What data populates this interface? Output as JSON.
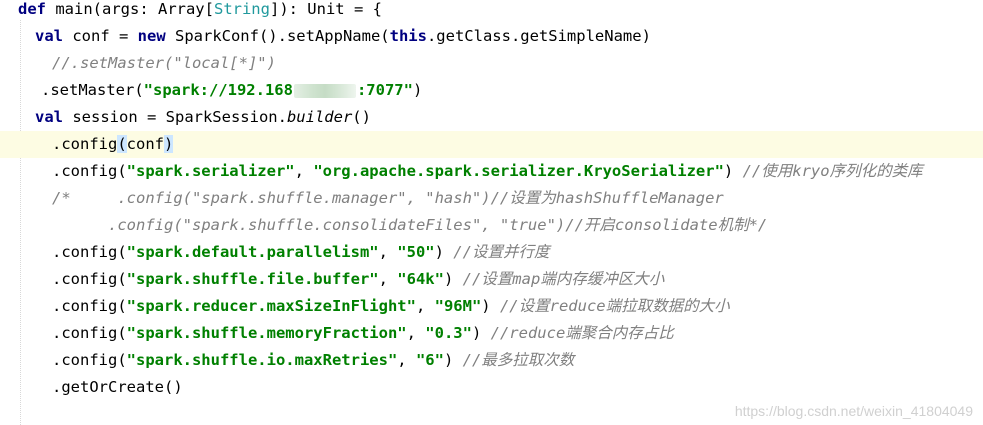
{
  "code": {
    "line1": {
      "def_kw": "def",
      "signature_a": " main(args: Array[",
      "string_type": "String",
      "signature_b": "]): Unit = {"
    },
    "line2": {
      "val_kw": "val",
      "a": " conf = ",
      "new_kw": "new",
      "b": " SparkConf().setAppName(",
      "this_kw": "this",
      "c": ".getClass.getSimpleName)"
    },
    "line3": {
      "comment": "//.setMaster(\"local[*]\")"
    },
    "line4": {
      "a": ".setMaster(",
      "string_visible_start": "\"spark://192.168",
      "string_visible_end": ":7077\"",
      "b": ")"
    },
    "line5": {
      "val_kw": "val",
      "a": " session = SparkSession.",
      "builder": "builder",
      "b": "()"
    },
    "line6": {
      "a": ".config",
      "open_paren": "(",
      "b": "conf",
      "close_paren": ")"
    },
    "line7": {
      "a": ".config(",
      "key": "\"spark.serializer\"",
      "sep": ", ",
      "value": "\"org.apache.spark.serializer.KryoSerializer\"",
      "b": ") ",
      "comment": "//使用kryo序列化的类库"
    },
    "line8": {
      "comment": "/*     .config(\"spark.shuffle.manager\", \"hash\")//设置为hashShuffleManager"
    },
    "line9": {
      "comment": ".config(\"spark.shuffle.consolidateFiles\", \"true\")//开启consolidate机制*/"
    },
    "config_lines": [
      {
        "a": ".config(",
        "key": "\"spark.default.parallelism\"",
        "sep": ", ",
        "value": "\"50\"",
        "b": ") ",
        "comment": "//设置并行度"
      },
      {
        "a": ".config(",
        "key": "\"spark.shuffle.file.buffer\"",
        "sep": ", ",
        "value": "\"64k\"",
        "b": ") ",
        "comment": "//设置map端内存缓冲区大小"
      },
      {
        "a": ".config(",
        "key": "\"spark.reducer.maxSizeInFlight\"",
        "sep": ", ",
        "value": "\"96M\"",
        "b": ") ",
        "comment": "//设置reduce端拉取数据的大小"
      },
      {
        "a": ".config(",
        "key": "\"spark.shuffle.memoryFraction\"",
        "sep": ", ",
        "value": "\"0.3\"",
        "b": ") ",
        "comment": "//reduce端聚合内存占比"
      },
      {
        "a": ".config(",
        "key": "\"spark.shuffle.io.maxRetries\"",
        "sep": ", ",
        "value": "\"6\"",
        "b": ") ",
        "comment": "//最多拉取次数"
      }
    ],
    "last_line": ".getOrCreate()"
  },
  "watermark": "https://blog.csdn.net/weixin_41804049",
  "colors": {
    "keyword": "#000080",
    "string": "#008000",
    "comment": "#808080",
    "type": "#20999d",
    "current_line": "#fdfce3",
    "bracket_highlight": "#cce6ff"
  }
}
